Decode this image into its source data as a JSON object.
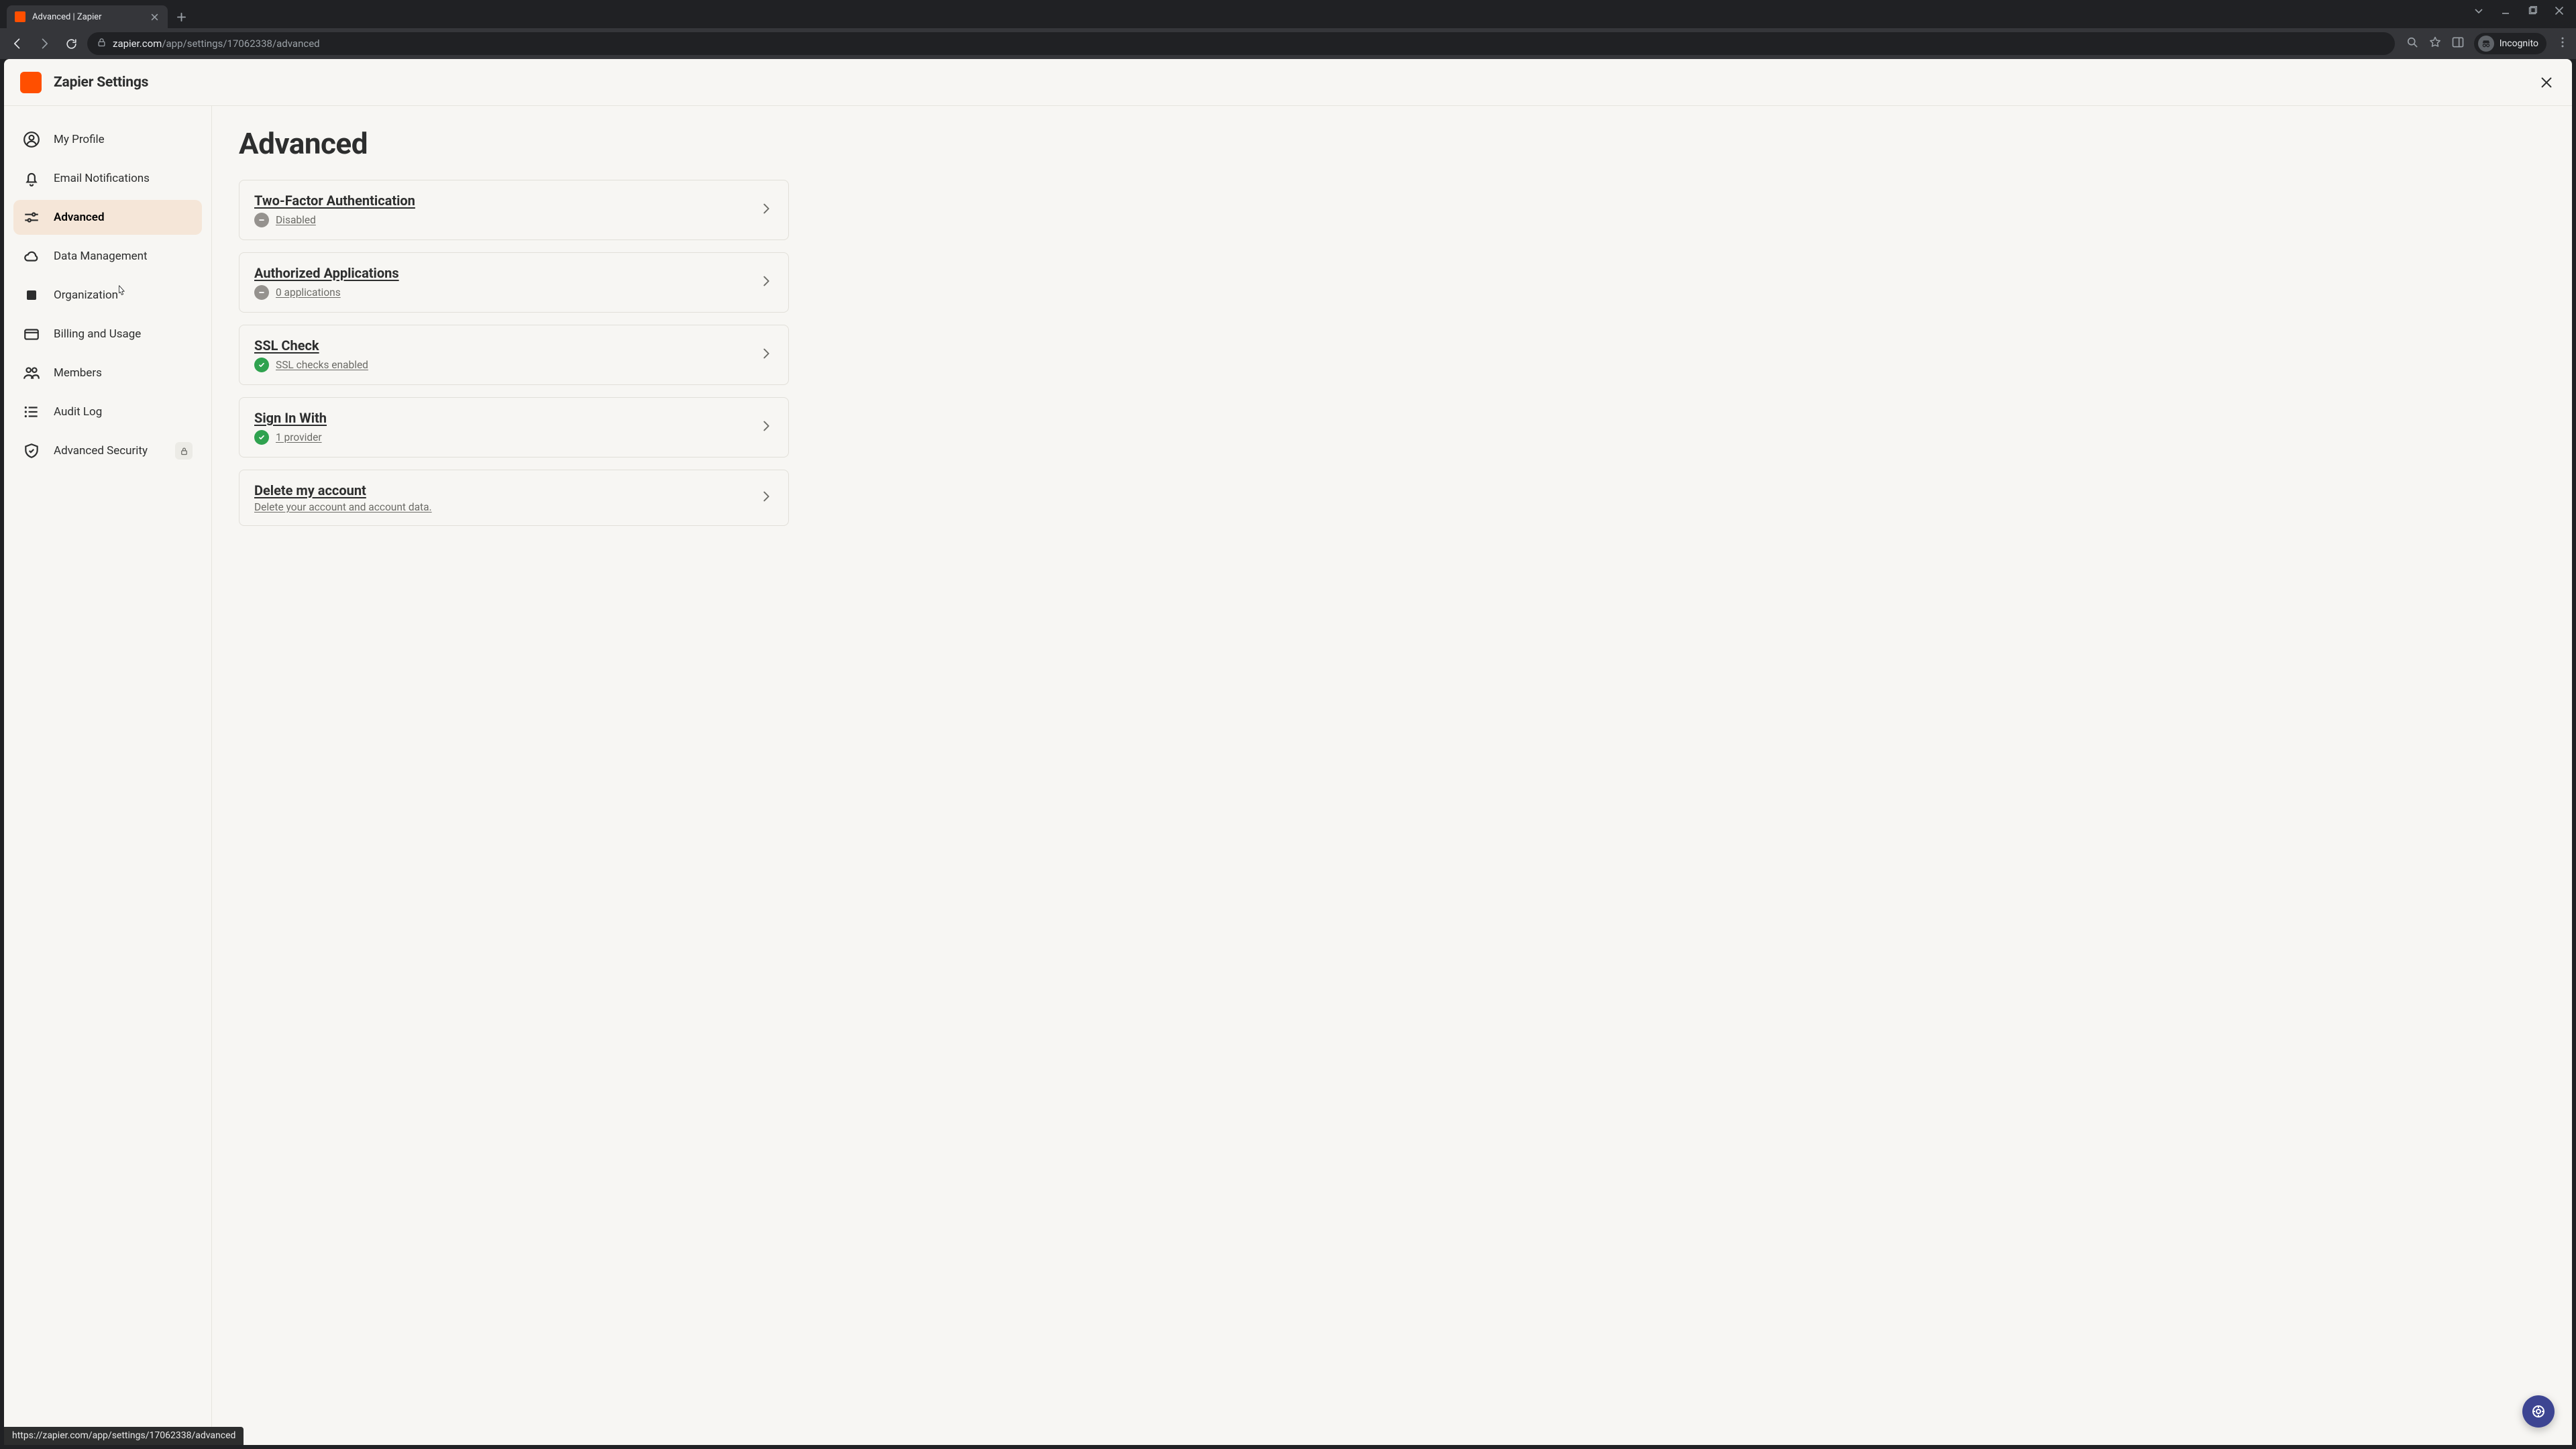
{
  "browser": {
    "tab_title": "Advanced | Zapier",
    "url_host": "zapier.com",
    "url_path": "/app/settings/17062338/advanced",
    "incognito_label": "Incognito",
    "status_url": "https://zapier.com/app/settings/17062338/advanced"
  },
  "header": {
    "title": "Zapier Settings"
  },
  "sidebar": {
    "items": [
      {
        "key": "profile",
        "label": "My Profile"
      },
      {
        "key": "email",
        "label": "Email Notifications"
      },
      {
        "key": "advanced",
        "label": "Advanced"
      },
      {
        "key": "data",
        "label": "Data Management"
      },
      {
        "key": "org",
        "label": "Organization"
      },
      {
        "key": "billing",
        "label": "Billing and Usage"
      },
      {
        "key": "members",
        "label": "Members"
      },
      {
        "key": "audit",
        "label": "Audit Log"
      },
      {
        "key": "sec",
        "label": "Advanced Security"
      }
    ]
  },
  "page": {
    "heading": "Advanced",
    "cards": [
      {
        "title": "Two-Factor Authentication",
        "status": "neutral",
        "sub": "Disabled"
      },
      {
        "title": "Authorized Applications",
        "status": "neutral",
        "sub": "0 applications"
      },
      {
        "title": "SSL Check",
        "status": "good",
        "sub": "SSL checks enabled"
      },
      {
        "title": "Sign In With",
        "status": "good",
        "sub": "1 provider"
      },
      {
        "title": "Delete my account",
        "status": "none",
        "sub": "Delete your account and account data."
      }
    ]
  },
  "colors": {
    "accent": "#ff4f00",
    "fab": "#3d4592",
    "good": "#2fa24f",
    "neutral": "#95928e"
  }
}
